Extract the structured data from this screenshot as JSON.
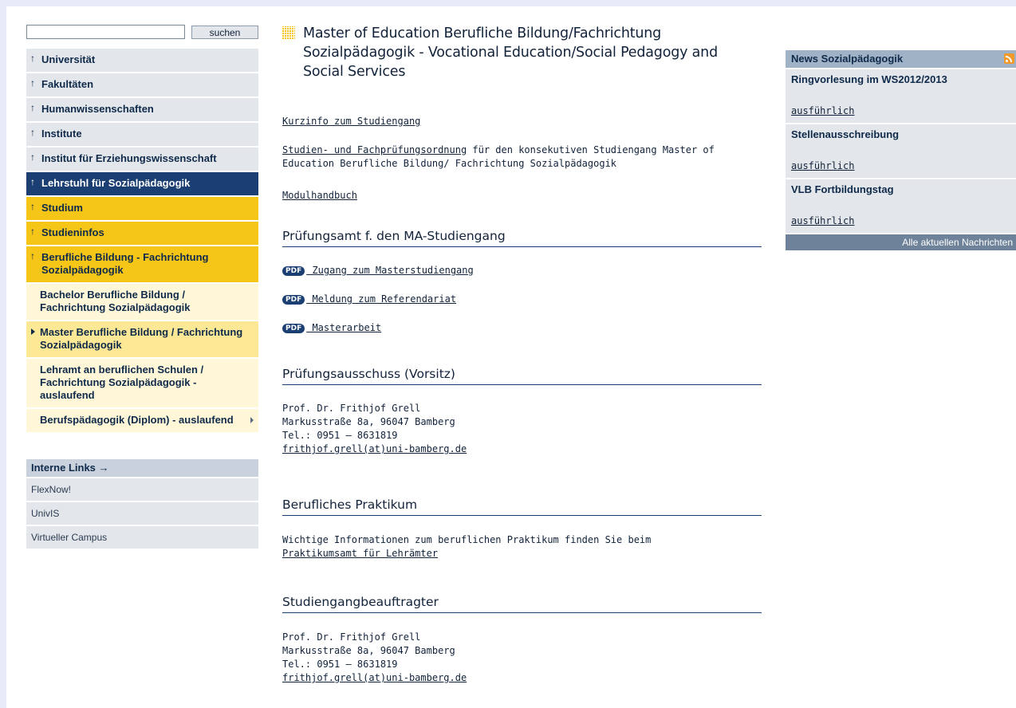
{
  "search": {
    "value": "",
    "button_label": "suchen"
  },
  "nav": {
    "items": [
      {
        "label": "Universität"
      },
      {
        "label": "Fakultäten"
      },
      {
        "label": "Humanwissenschaften"
      },
      {
        "label": "Institute"
      },
      {
        "label": "Institut für Erziehungswissenschaft"
      },
      {
        "label": "Lehrstuhl für Sozialpädagogik"
      },
      {
        "label": "Studium"
      },
      {
        "label": "Studieninfos"
      },
      {
        "label": "Berufliche Bildung - Fachrichtung Sozialpädagogik"
      },
      {
        "label": "Bachelor Berufliche Bildung / Fachrichtung Sozialpädagogik"
      },
      {
        "label": "Master Berufliche Bildung / Fachrichtung Sozialpädagogik"
      },
      {
        "label": "Lehramt an beruflichen Schulen / Fachrichtung Sozialpädagogik - auslaufend"
      },
      {
        "label": "Berufspädagogik (Diplom) - auslaufend"
      }
    ],
    "arrow_glyph": "↑"
  },
  "internal_links": {
    "title": "Interne Links →",
    "items": [
      {
        "label": "FlexNow!"
      },
      {
        "label": "UnivIS"
      },
      {
        "label": "Virtueller Campus"
      }
    ]
  },
  "main": {
    "title": "Master of Education Berufliche Bildung/Fachrichtung Sozialpädagogik - Vocational Education/Social Pedagogy and Social Services",
    "kurzinfo_link": "Kurzinfo zum Studiengang",
    "pruefungsordnung_link": "Studien- und Fachprüfungsordnung",
    "pruefungsordnung_text": " für den konsekutiven Studiengang Master of Education Berufliche Bildung/ Fachrichtung Sozialpädagogik",
    "modulhandbuch_link": "Modulhandbuch",
    "sections": {
      "pruefungsamt": {
        "heading": "Prüfungsamt f. den MA-Studiengang",
        "pdf_label": "PDF",
        "files": [
          {
            "label": " Zugang zum Masterstudiengang"
          },
          {
            "label": " Meldung zum Referendariat"
          },
          {
            "label": " Masterarbeit"
          }
        ]
      },
      "ausschuss": {
        "heading": "Prüfungsausschuss (Vorsitz)",
        "name": "Prof. Dr. Frithjof Grell",
        "address": "Markusstraße 8a, 96047 Bamberg",
        "phone": "Tel.: 0951 – 8631819",
        "email": "frithjof.grell(at)uni-bamberg.de"
      },
      "praktikum": {
        "heading": "Berufliches Praktikum",
        "text": "Wichtige Informationen zum beruflichen Praktikum finden Sie beim",
        "link": "Praktikumsamt für Lehrämter"
      },
      "beauftragter": {
        "heading": "Studiengangbeauftragter",
        "name": "Prof. Dr. Frithjof Grell",
        "address": "Markusstraße 8a, 96047 Bamberg",
        "phone": "Tel.: 0951 – 8631819",
        "email": "frithjof.grell(at)uni-bamberg.de"
      }
    }
  },
  "news": {
    "title": "News Sozialpädagogik",
    "icon": "rss-icon",
    "entries": [
      {
        "title": "Ringvorlesung im WS2012/2013",
        "more": "ausführlich"
      },
      {
        "title": "Stellenausschreibung",
        "more": "ausführlich"
      },
      {
        "title": "VLB Fortbildungstag",
        "more": "ausführlich"
      }
    ],
    "all_label": "Alle aktuellen Nachrichten"
  },
  "colors": {
    "background": "#e9eaf7",
    "nav_grey": "#e3e6ea",
    "nav_dark": "#1b3f72",
    "nav_gold": "#f5c518",
    "nav_cream": "#fff7d8",
    "nav_selected": "#fde895",
    "news_head": "#9fb2c6"
  }
}
